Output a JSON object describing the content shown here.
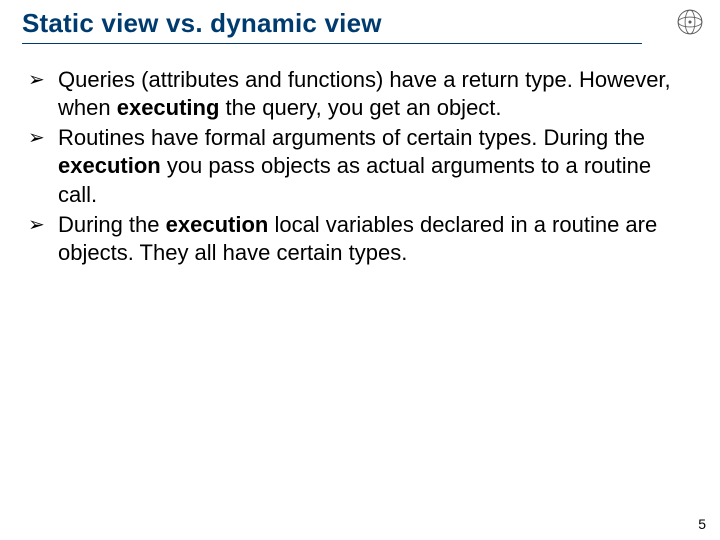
{
  "title": "Static view vs. dynamic view",
  "bullets": [
    {
      "pre": "Queries (attributes and functions) have a return type. However, when ",
      "bold": "executing",
      "post": " the query, you get an object."
    },
    {
      "pre": "Routines have formal arguments of certain types. During the ",
      "bold": "execution",
      "post": " you pass objects as actual arguments to a routine call."
    },
    {
      "pre": "During the ",
      "bold": "execution",
      "post": " local variables declared in a routine are objects. They all have certain types."
    }
  ],
  "page_number": "5",
  "bullet_glyph": "➢"
}
